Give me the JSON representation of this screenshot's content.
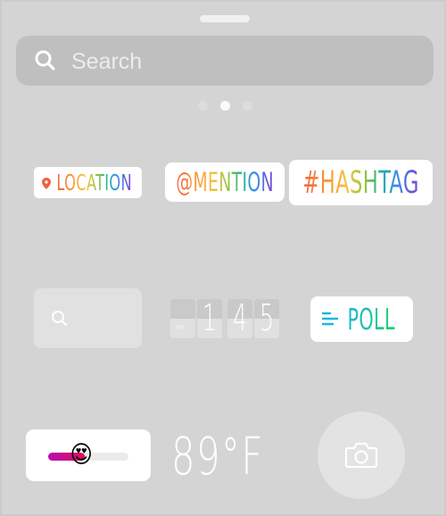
{
  "search": {
    "placeholder": "Search",
    "icon": "search-icon"
  },
  "pager": {
    "count": 3,
    "active_index": 1
  },
  "stickers": {
    "location": {
      "label": "LOCATION",
      "icon": "location-pin-icon"
    },
    "mention": {
      "label": "@MENTION"
    },
    "hashtag": {
      "label": "#HASHTAG"
    },
    "gif": {
      "icon": "search-icon"
    },
    "clock": {
      "ampm": "PM",
      "digits": [
        "",
        "1",
        "4",
        "5"
      ]
    },
    "poll": {
      "label": "POLL",
      "icon": "poll-lines-icon"
    },
    "emoji_slider": {
      "emoji": "😍",
      "value_fraction": 0.45
    },
    "temperature": {
      "label": "89°F"
    },
    "camera": {
      "icon": "camera-icon"
    }
  },
  "colors": {
    "background": "#d4d4d4",
    "search_field": "#bfbfbf",
    "sticker_bg": "#ffffff",
    "poll_gradient": [
      "#1cb7d8",
      "#1fd36a"
    ],
    "slider_gradient": [
      "#b50fb0",
      "#e30b5c"
    ]
  }
}
